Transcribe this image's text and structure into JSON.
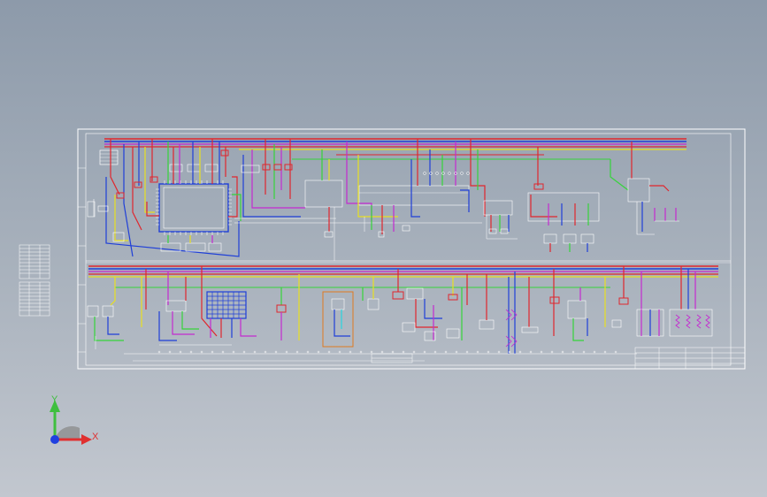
{
  "view": {
    "background_top": "#8d9aaa",
    "background_bottom": "#c2c7cf"
  },
  "colors": {
    "frame": "#ffffff",
    "red": "#e0262d",
    "blue": "#1f3fd8",
    "green": "#35d43a",
    "yellow": "#e8e020",
    "magenta": "#c42ad0",
    "cyan": "#27d6e0",
    "orange": "#e07a20",
    "dark_red": "#9b1010",
    "axis_y": "#3fbf3f",
    "axis_x": "#e03030",
    "axis_z": "#2040e0"
  },
  "coordinate_indicator": {
    "y_label": "Y",
    "x_label": "X",
    "icons": [
      "ucs-axis-icon"
    ]
  },
  "schematic": {
    "top_section": "upper-circuit",
    "bottom_section": "lower-circuit",
    "title_block": "title-block"
  }
}
